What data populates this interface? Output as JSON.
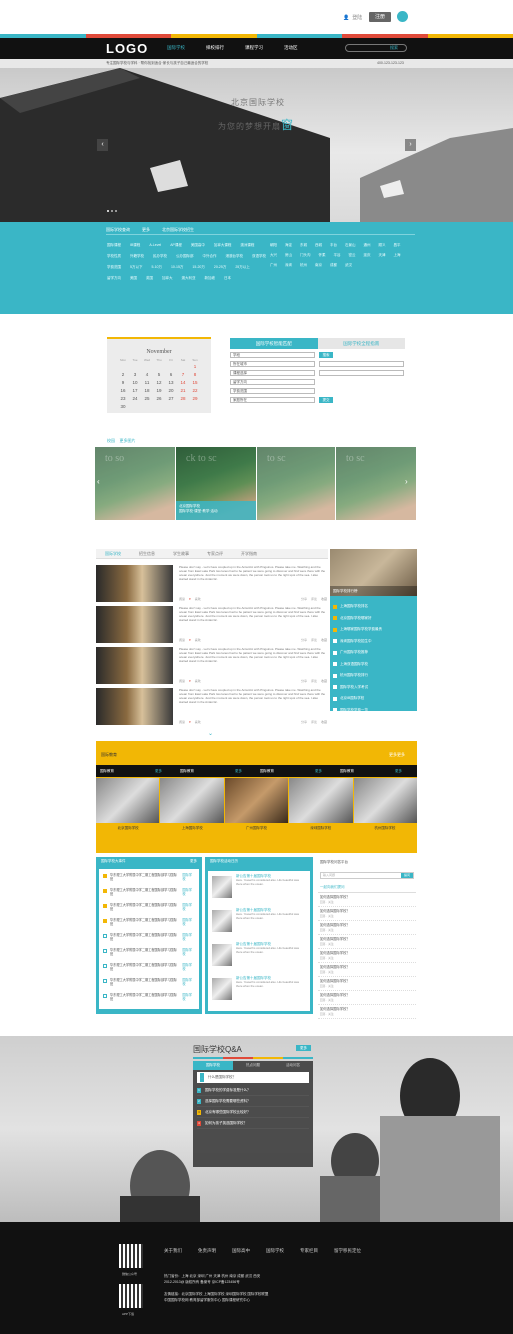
{
  "header": {
    "login_label": "登陆",
    "register_label": "注册",
    "logo": "LOGO",
    "nav": [
      "国际学校",
      "择校排行",
      "课程学习",
      "活动区"
    ],
    "search_placeholder": "搜索",
    "subbar_left": "专注国际学校与学科 · 帮你找到适合·家长与孩子自己最适合的学校",
    "subbar_right": "400-123-123-123",
    "stripe_colors": [
      "#3ab6c6",
      "#e04a3a",
      "#f2b705",
      "#3ab6c6",
      "#e04a3a",
      "#f2b705"
    ]
  },
  "hero": {
    "title": "北京国际学校",
    "subtitle": "为您的梦想开扇",
    "subtitle_accent": "窗",
    "prev": "‹",
    "next": "›"
  },
  "filter": {
    "head": [
      "国际学校查询",
      "更多",
      "北京国际学校招生"
    ],
    "rows": [
      [
        "国际课程",
        "IB课程",
        "A-Level",
        "AP课程",
        "美国高中",
        "加拿大课程",
        "澳洲课程"
      ],
      [
        "学校性质",
        "外籍学校",
        "民办学校",
        "公办国际部",
        "中外合作",
        "港澳台学校",
        "双语学校"
      ],
      [
        "学费范围",
        "5万以下",
        "5-10万",
        "10-15万",
        "15-20万",
        "20-25万",
        "25万以上"
      ],
      [
        "留学方向",
        "美国",
        "英国",
        "加拿大",
        "澳大利亚",
        "新加坡",
        "日本"
      ]
    ],
    "regions": [
      "朝阳",
      "海淀",
      "东城",
      "西城",
      "丰台",
      "石景山",
      "通州",
      "顺义",
      "昌平",
      "大兴",
      "房山",
      "门头沟",
      "怀柔",
      "平谷",
      "密云",
      "延庆",
      "天津",
      "上海",
      "广州",
      "深圳",
      "杭州",
      "南京",
      "成都",
      "武汉"
    ]
  },
  "calendar": {
    "month": "November",
    "days": [
      "Mon",
      "Tue",
      "Wed",
      "Thu",
      "Fri",
      "Sat",
      "Sun"
    ],
    "weeks": [
      [
        "",
        "",
        "",
        "",
        "",
        "",
        "1"
      ],
      [
        "2",
        "3",
        "4",
        "5",
        "6",
        "7",
        "8"
      ],
      [
        "9",
        "10",
        "11",
        "12",
        "13",
        "14",
        "15"
      ],
      [
        "16",
        "17",
        "18",
        "19",
        "20",
        "21",
        "22"
      ],
      [
        "23",
        "24",
        "25",
        "26",
        "27",
        "28",
        "29"
      ],
      [
        "30",
        "",
        "",
        "",
        "",
        "",
        ""
      ]
    ]
  },
  "match": {
    "tab_active": "国际学校智能匹配",
    "tab_other": "国际学校全程指南",
    "fields": [
      "学段",
      "所在城市",
      "课程选择",
      "留学方向",
      "学费范围",
      "家庭所在"
    ],
    "search_btn": "搜索",
    "submit_btn": "提交"
  },
  "gallery": {
    "label1": "校园",
    "label2": "更多图片",
    "caption_title": "北京国际学校",
    "caption_desc": "国际学校·课堂·教学·活动"
  },
  "news": {
    "tabs": [
      "国际学校",
      "招生信息",
      "学生故事",
      "专家点评",
      "开学指南"
    ],
    "body": "Please don't say - Let's have coupled up in the Antarctic with Pinguinos. Please take me. Watching and the ocean from East Lake Park two lanes had to be patient we were going to discover and find were there with the ocean everywhere. Just the moment we were down, the person took us to the right spot of the sea. I also started stand in the Antarctic.",
    "meta_views": "阅读",
    "meta_likes": "喜欢",
    "meta_share": "分享",
    "meta_comment": "评论",
    "meta_fav": "收藏"
  },
  "side": {
    "caption": "国际学校排行榜",
    "items": [
      "上海国际学校排名",
      "北京国际学校哪家好",
      "上海哪家国际学校学费最贵",
      "深圳国际学校招生中",
      "广州国际学校推荐",
      "上海双语国际学校",
      "杭州国际学校排行",
      "国际学校入学考试",
      "北京IB国际学校",
      "国际学校学费一览"
    ]
  },
  "yellow": {
    "title": "国际教育",
    "more": "更多更多",
    "tabs": [
      [
        "国际教育",
        "更多"
      ],
      [
        "国际教育",
        "更多"
      ],
      [
        "国际教育",
        "更多"
      ],
      [
        "国际教育",
        "更多"
      ]
    ],
    "captions": [
      "北京国际学校",
      "上海国际学校",
      "广州国际学校",
      "深圳国际学校",
      "杭州国际学校"
    ]
  },
  "col1": {
    "title": "国际学校大事件",
    "more": "更多",
    "tag": "国际学校",
    "items": [
      "华东理工大学附属中学二期工程国际部学习国际班",
      "华东理工大学附属中学二期工程国际部学习国际班",
      "华东理工大学附属中学二期工程国际部学习国际班",
      "华东理工大学附属中学二期工程国际部学习国际班",
      "华东理工大学附属中学二期工程国际部学习国际班",
      "华东理工大学附属中学二期工程国际部学习国际班",
      "华东理工大学附属中学二期工程国际部学习国际班",
      "华东理工大学附属中学二期工程国际部学习国际班",
      "华东理工大学附属中学二期工程国际部学习国际班"
    ]
  },
  "col2": {
    "title": "国际学校活动日历",
    "items": [
      {
        "t": "新公告第十届国际学校",
        "d": "Here. Youself is considered also. Life beautiful was there when the ocean."
      },
      {
        "t": "新公告第十届国际学校",
        "d": "Here. Youself is considered also. Life beautiful was there when the ocean."
      },
      {
        "t": "新公告第十届国际学校",
        "d": "Here. Youself is considered also. Life beautiful was there when the ocean."
      },
      {
        "t": "新公告第十届国际学校",
        "d": "Here. Youself is considered also. Life beautiful was there when the ocean."
      }
    ]
  },
  "col3": {
    "title": "国际学校问答平台",
    "input_ph": "输入问题",
    "btn": "提问",
    "sub": "一起向我们提问",
    "qs": [
      "如何选择国际学校？",
      "如何选择国际学校？",
      "如何选择国际学校？",
      "如何选择国际学校？",
      "如何选择国际学校？",
      "如何选择国际学校？",
      "如何选择国际学校？",
      "如何选择国际学校？",
      "如何选择国际学校？"
    ],
    "q_sub": "回答 · 关注"
  },
  "qa": {
    "title": "国际学校Q&A",
    "more": "更多",
    "tabs": [
      "国际学校",
      "热点问题",
      "活动问答"
    ],
    "input": "什么是国际学校？",
    "rows": [
      "国际学校的学费标准是什么？",
      "选择国际学校需要哪些资料？",
      "北京有哪些国际学校比较好？",
      "如何为孩子挑选国际学校？"
    ],
    "nums": [
      "1",
      "2",
      "3",
      "4"
    ]
  },
  "footer": {
    "links": [
      "关于我们",
      "免责声明",
      "国际高中",
      "国际学校",
      "专家栏目",
      "留学移民定位"
    ],
    "qr1": "微信公众号",
    "qr2": "APP下载",
    "addr1": "热门省份：上海 北京 深圳 广州 天津 杭州 南京 成都 武汉 西安",
    "addr2": "2012-2013@ 版权所有 备案号 京ICP备123456号",
    "addr3": "友情链接：北京国际学校 上海国际学校 深圳国际学校 国际学校联盟",
    "addr4": "中国国际学校网 教育部留学服务中心 国际课程研究中心"
  }
}
